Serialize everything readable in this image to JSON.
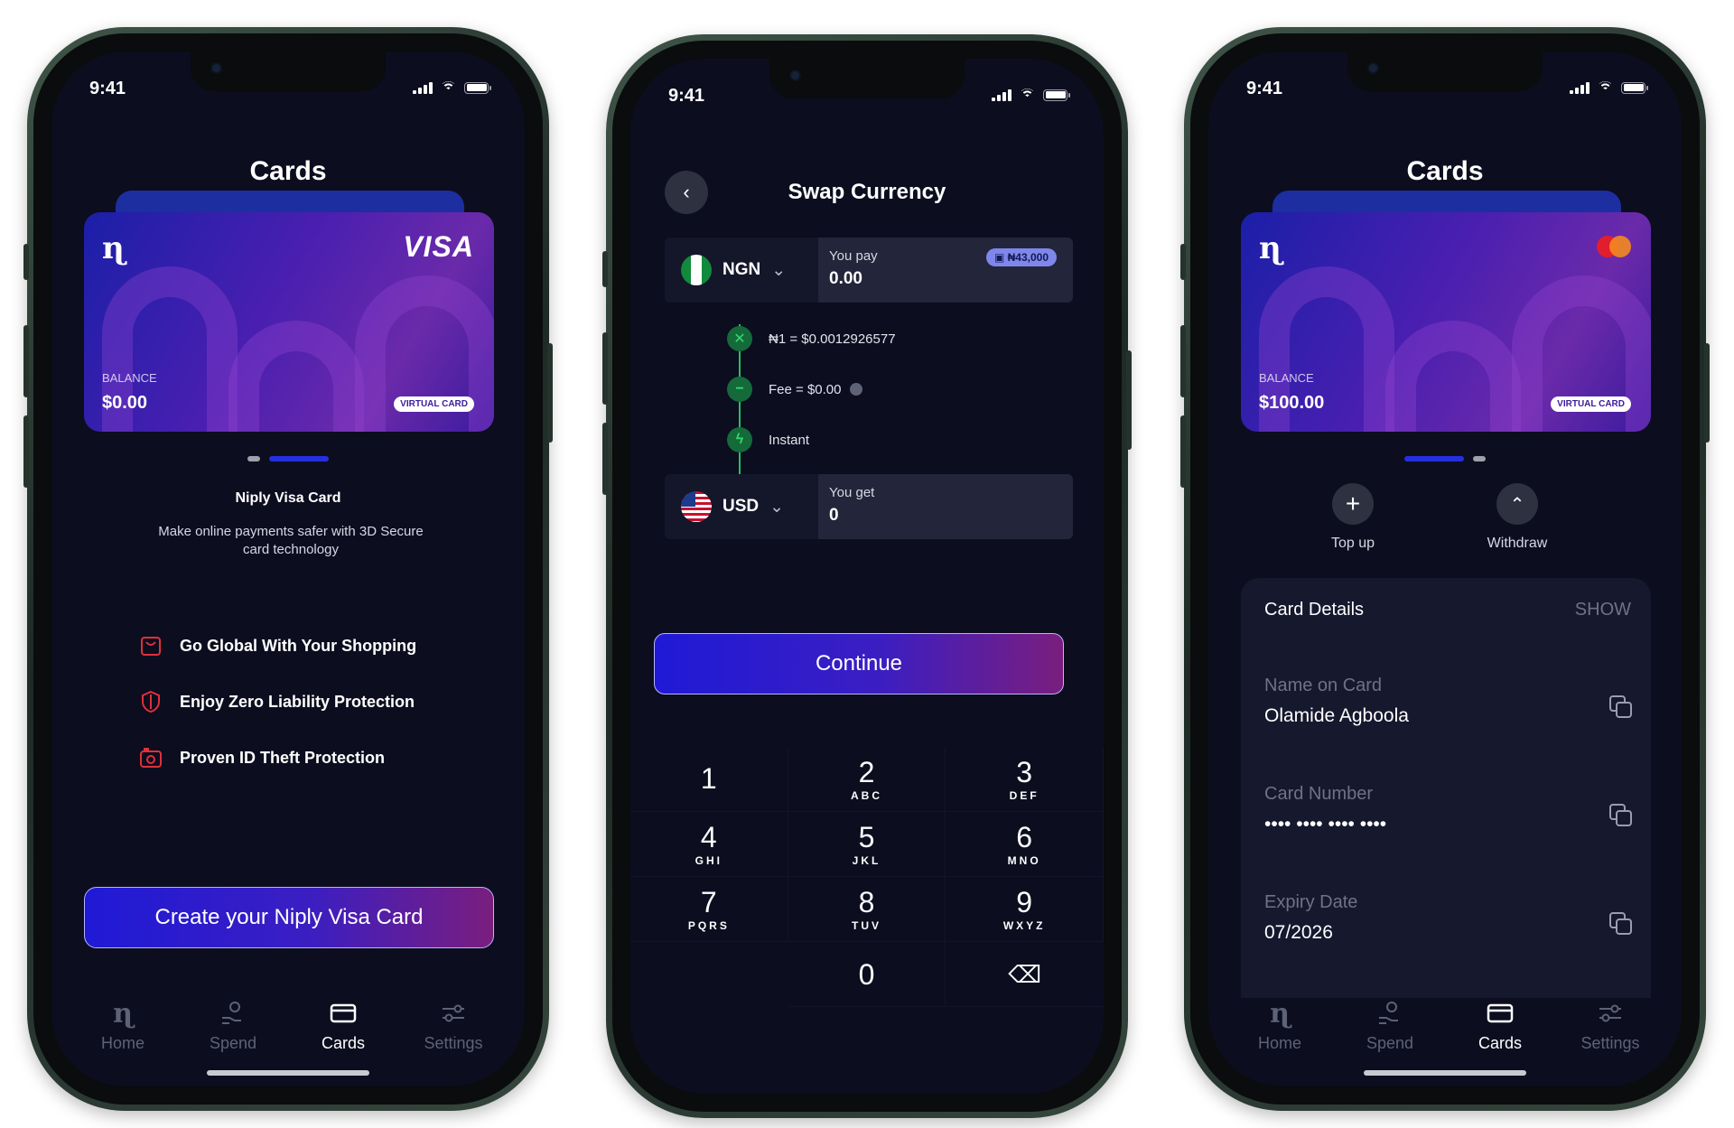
{
  "status": {
    "time": "9:41"
  },
  "screen1": {
    "title": "Cards",
    "card": {
      "balance_label": "BALANCE",
      "balance_value": "$0.00",
      "tag": "VIRTUAL CARD",
      "brand": "VISA",
      "logo_char": "ɳ"
    },
    "card_name": "Niply Visa Card",
    "subtitle": "Make online payments safer with 3D Secure card technology",
    "features": [
      {
        "icon": "shopping-bag-icon",
        "label": "Go Global With Your Shopping"
      },
      {
        "icon": "shield-icon",
        "label": "Enjoy Zero Liability Protection"
      },
      {
        "icon": "id-camera-icon",
        "label": "Proven ID Theft Protection"
      }
    ],
    "cta": "Create your Niply Visa Card"
  },
  "screen2": {
    "title": "Swap Currency",
    "pay": {
      "currency": "NGN",
      "label": "You pay",
      "value": "0.00",
      "wallet": "₦43,000"
    },
    "steps": [
      {
        "icon": "cross-icon",
        "text": "₦1 = $0.0012926577"
      },
      {
        "icon": "minus-icon",
        "text": "Fee = $0.00"
      },
      {
        "icon": "lightning-icon",
        "text": "Instant"
      }
    ],
    "get": {
      "currency": "USD",
      "label": "You get",
      "value": "0"
    },
    "cta": "Continue",
    "keys": [
      {
        "n": "1",
        "l": ""
      },
      {
        "n": "2",
        "l": "ABC"
      },
      {
        "n": "3",
        "l": "DEF"
      },
      {
        "n": "4",
        "l": "GHI"
      },
      {
        "n": "5",
        "l": "JKL"
      },
      {
        "n": "6",
        "l": "MNO"
      },
      {
        "n": "7",
        "l": "PQRS"
      },
      {
        "n": "8",
        "l": "TUV"
      },
      {
        "n": "9",
        "l": "WXYZ"
      },
      {
        "n": "",
        "l": ""
      },
      {
        "n": "0",
        "l": ""
      },
      {
        "n": "⌫",
        "l": ""
      }
    ]
  },
  "screen3": {
    "title": "Cards",
    "card": {
      "balance_label": "BALANCE",
      "balance_value": "$100.00",
      "tag": "VIRTUAL CARD",
      "logo_char": "ɳ"
    },
    "actions": {
      "topup": "Top up",
      "withdraw": "Withdraw"
    },
    "details": {
      "heading": "Card Details",
      "show": "SHOW",
      "name_label": "Name on Card",
      "name_value": "Olamide Agboola",
      "number_label": "Card Number",
      "number_value": "•••• •••• •••• ••••",
      "expiry_label": "Expiry Date",
      "expiry_value": "07/2026"
    }
  },
  "tabs": [
    "Home",
    "Spend",
    "Cards",
    "Settings"
  ],
  "colors": {
    "background": "#0c0d1f",
    "accent": "#2a1fd6",
    "danger": "#e0303a",
    "success": "#22c064"
  }
}
